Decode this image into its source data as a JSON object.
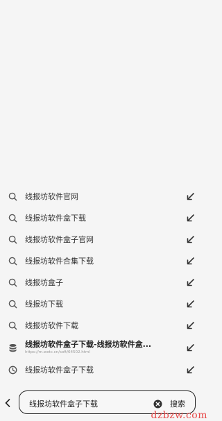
{
  "suggestions": [
    {
      "icon": "search-icon",
      "label": "线报坊软件官网"
    },
    {
      "icon": "search-icon",
      "label": "线报坊软件盒下载"
    },
    {
      "icon": "search-icon",
      "label": "线报坊软件盒子官网"
    },
    {
      "icon": "search-icon",
      "label": "线报坊软件合集下载"
    },
    {
      "icon": "search-icon",
      "label": "线报坊盒子"
    },
    {
      "icon": "search-icon",
      "label": "线报坊下载"
    },
    {
      "icon": "search-icon",
      "label": "线报坊软件下载"
    },
    {
      "icon": "database-icon",
      "label": "线报坊软件盒子下载-线报坊软件盒...",
      "url": "https://m.wotc.cn/soft/64502.html"
    },
    {
      "icon": "history-icon",
      "label": "线报坊软件盒子下载"
    }
  ],
  "search": {
    "query": "线报坊软件盒子下载",
    "button_label": "搜索"
  },
  "watermark": "dzbzw.com"
}
